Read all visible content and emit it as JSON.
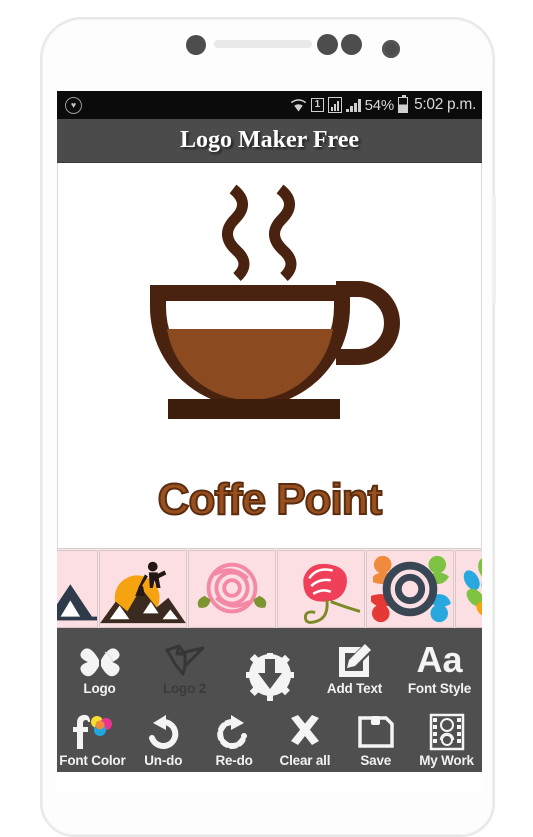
{
  "status_bar": {
    "left_icon": "shield-icon",
    "icons": [
      "wifi-icon",
      "sim-1-icon",
      "signal-box-icon",
      "signal-bars-icon"
    ],
    "sim_label": "1",
    "battery_percent": "54%",
    "battery_icon": "battery-charging-icon",
    "time": "5:02 p.m."
  },
  "app": {
    "title": "Logo Maker Free"
  },
  "canvas": {
    "logo_text": "Coffe Point",
    "logo_colors": {
      "cup_outline": "#4a2310",
      "coffee_fill": "#8c4a20",
      "text": "#9a4f1e",
      "bar": "#3d1d0c"
    }
  },
  "thumbnails": [
    {
      "name": "mountain-thumb",
      "label": "mountain"
    },
    {
      "name": "hiker-sunset-thumb",
      "label": "hiker sunset"
    },
    {
      "name": "pink-rose-thumb",
      "label": "pink rose"
    },
    {
      "name": "red-rose-thumb",
      "label": "red rose"
    },
    {
      "name": "people-circle-thumb",
      "label": "people circle"
    },
    {
      "name": "tree-person-thumb",
      "label": "tree person"
    }
  ],
  "toolbar": {
    "row1": [
      {
        "name": "logo-button",
        "label": "Logo",
        "icon": "leaf-butterfly-icon",
        "state": "active"
      },
      {
        "name": "logo2-button",
        "label": "Logo 2",
        "icon": "origami-bird-icon",
        "state": "dim"
      },
      {
        "name": "background-button",
        "label": "",
        "icon": "gear-download-icon",
        "state": "blank"
      },
      {
        "name": "add-text-button",
        "label": "Add Text",
        "icon": "edit-pencil-icon",
        "state": "active"
      },
      {
        "name": "font-style-button",
        "label": "Font Style",
        "icon": "aa-icon",
        "state": "active"
      }
    ],
    "row2": [
      {
        "name": "font-color-button",
        "label": "Font Color",
        "icon": "f-color-icon",
        "state": "active"
      },
      {
        "name": "undo-button",
        "label": "Un-do",
        "icon": "undo-arrow-icon",
        "state": "active"
      },
      {
        "name": "redo-button",
        "label": "Re-do",
        "icon": "redo-arrow-icon",
        "state": "active"
      },
      {
        "name": "clear-all-button",
        "label": "Clear all",
        "icon": "close-x-icon",
        "state": "active"
      },
      {
        "name": "save-button",
        "label": "Save",
        "icon": "floppy-disk-icon",
        "state": "active"
      },
      {
        "name": "my-work-button",
        "label": "My Work",
        "icon": "film-strip-icon",
        "state": "active"
      }
    ]
  }
}
